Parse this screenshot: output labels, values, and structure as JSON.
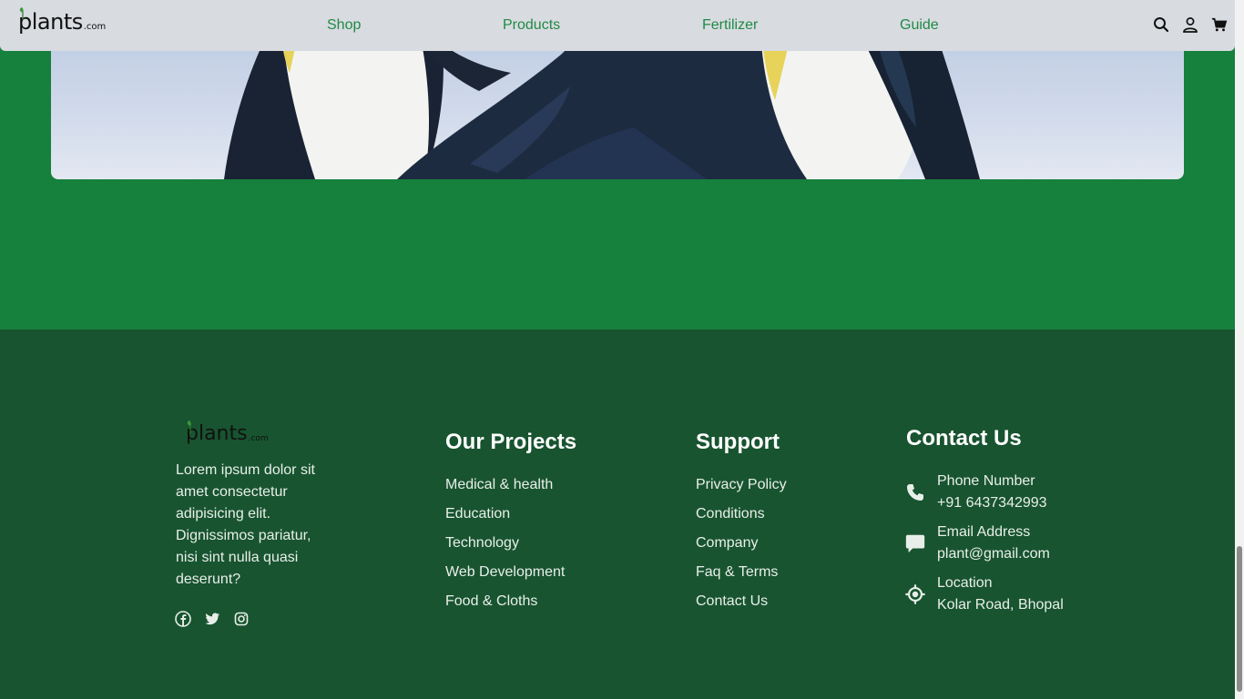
{
  "header": {
    "logo_main": "plants",
    "logo_domain": ".com",
    "nav": [
      {
        "label": "Shop"
      },
      {
        "label": "Products"
      },
      {
        "label": "Fertilizer"
      },
      {
        "label": "Guide"
      }
    ],
    "icons": [
      "search-icon",
      "user-icon",
      "cart-icon"
    ]
  },
  "footer": {
    "logo_main": "plants",
    "logo_domain": ".com",
    "about": "Lorem ipsum dolor sit amet consectetur adipisicing elit. Dignissimos pariatur, nisi sint nulla quasi deserunt?",
    "social": [
      "facebook-icon",
      "twitter-icon",
      "instagram-icon"
    ],
    "projects": {
      "title": "Our Projects",
      "items": [
        "Medical & health",
        "Education",
        "Technology",
        "Web Development",
        "Food & Cloths"
      ]
    },
    "support": {
      "title": "Support",
      "items": [
        "Privacy Policy",
        "Conditions",
        "Company",
        "Faq & Terms",
        "Contact Us"
      ]
    },
    "contact": {
      "title": "Contact Us",
      "items": [
        {
          "label": "Phone Number",
          "value": "+91 6437342993",
          "icon": "phone-icon"
        },
        {
          "label": "Email Address",
          "value": "plant@gmail.com",
          "icon": "chat-icon"
        },
        {
          "label": "Location",
          "value": "Kolar Road, Bhopal",
          "icon": "location-icon"
        }
      ]
    }
  },
  "colors": {
    "page_bg": "#16803d",
    "footer_bg": "#185430",
    "nav_link": "#1f8a45",
    "navbar_bg": "#d8dbe0"
  }
}
